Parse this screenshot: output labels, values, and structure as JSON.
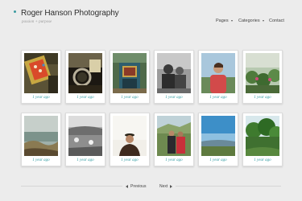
{
  "header": {
    "title": "Roger Hanson Photography",
    "tagline": "passion + purpose"
  },
  "nav": {
    "pages": "Pages",
    "categories": "Categories",
    "contact": "Contact"
  },
  "posts": [
    {
      "caption": "1 year ago"
    },
    {
      "caption": "1 year ago"
    },
    {
      "caption": "1 year ago"
    },
    {
      "caption": "1 year ago"
    },
    {
      "caption": "1 year ago"
    },
    {
      "caption": "1 year ago"
    },
    {
      "caption": "1 year ago"
    },
    {
      "caption": "1 year ago"
    },
    {
      "caption": "1 year ago"
    },
    {
      "caption": "1 year ago"
    },
    {
      "caption": "1 year ago"
    },
    {
      "caption": "1 year ago"
    }
  ],
  "pagination": {
    "previous": "Previous",
    "next": "Next"
  },
  "colors": {
    "accent": "#2f9aa0",
    "background": "#ececec"
  }
}
